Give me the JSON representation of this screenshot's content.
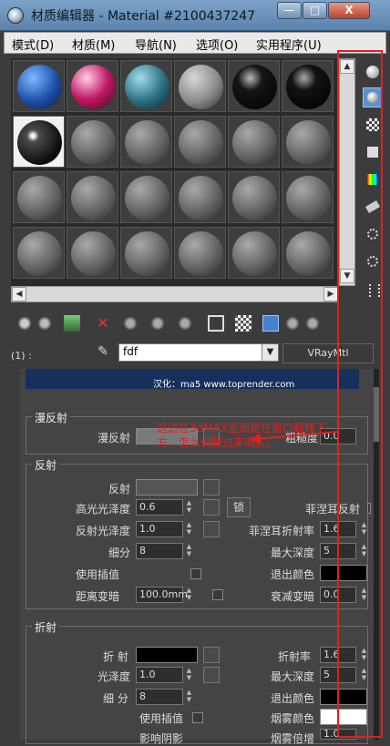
{
  "window": {
    "title": "材质编辑器 - Material #2100437247",
    "buttons": {
      "minimize": "—",
      "maximize": "□",
      "close": "X"
    }
  },
  "menu": [
    "模式(D)",
    "材质(M)",
    "导航(N)",
    "选项(O)",
    "实用程序(U)"
  ],
  "material": {
    "slot_label": "(1) :",
    "name": "fdf",
    "type": "VRayMtl"
  },
  "banner": {
    "text": "汉化：ma5 www.toprender.com"
  },
  "annotation": "这边在3dMAX里面是在窗口翻转下方，怎么调整过来啊。。。",
  "diffuse": {
    "title": "漫反射",
    "label": "漫反射",
    "roughness_label": "粗糙度",
    "roughness_value": "0.0"
  },
  "reflection": {
    "title": "反射",
    "reflect": "反射",
    "hilight_gloss": "高光光泽度",
    "hilight_value": "0.6",
    "lock": "锁",
    "fresnel": "菲涅耳反射",
    "refl_gloss": "反射光泽度",
    "refl_gloss_value": "1.0",
    "fresnel_ior": "菲涅耳折射率",
    "fresnel_ior_value": "1.6",
    "subdivs": "细分",
    "subdivs_value": "8",
    "max_depth": "最大深度",
    "max_depth_value": "5",
    "use_interp": "使用插值",
    "exit_color": "退出颜色",
    "dim_distance": "距离变暗",
    "dim_value": "100.0mm",
    "dim_falloff": "衰减变暗",
    "dim_falloff_value": "0.0"
  },
  "refraction": {
    "title": "折射",
    "refract": "折 射",
    "ior": "折射率",
    "ior_value": "1.6",
    "glossiness": "光泽度",
    "glossiness_value": "1.0",
    "max_depth": "最大深度",
    "max_depth_value": "5",
    "subdivs": "细 分",
    "subdivs_value": "8",
    "exit_color": "退出颜色",
    "use_interp": "使用插值",
    "fog_color": "烟雾颜色",
    "affect_shadows": "影响阴影",
    "fog_multiplier": "烟雾倍增",
    "fog_mult_value": "1.0"
  },
  "colors": {
    "highlight_frame": "#e02020",
    "title_bar": "#6b93bd",
    "panel": "#444444"
  }
}
